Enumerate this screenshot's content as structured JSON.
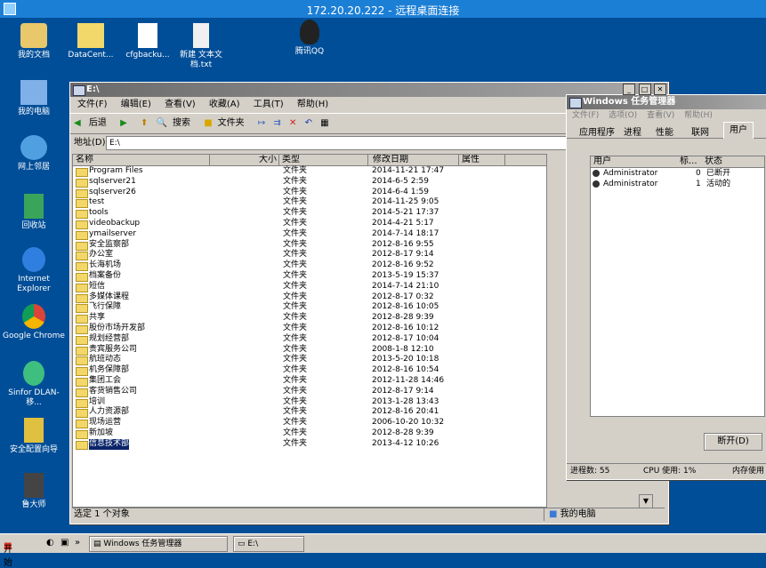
{
  "rdp": {
    "title": "172.20.20.222 - 远程桌面连接"
  },
  "desktop_icons": [
    {
      "label": "我的文档",
      "icon": "documents-icon"
    },
    {
      "label": "DataCent...",
      "icon": "folder-icon"
    },
    {
      "label": "cfgbacku...",
      "icon": "file-icon"
    },
    {
      "label": "新建 文本文档.txt",
      "icon": "text-file-icon"
    },
    {
      "label": "腾讯QQ",
      "icon": "qq-icon"
    },
    {
      "label": "我的电脑",
      "icon": "computer-icon"
    },
    {
      "label": "网上邻居",
      "icon": "network-icon"
    },
    {
      "label": "回收站",
      "icon": "recycle-bin-icon"
    },
    {
      "label": "Internet Explorer",
      "icon": "ie-icon"
    },
    {
      "label": "Google Chrome",
      "icon": "chrome-icon"
    },
    {
      "label": "Sinfor DLAN-移...",
      "icon": "sinfor-icon"
    },
    {
      "label": "安全配置向导",
      "icon": "security-wizard-icon"
    },
    {
      "label": "鲁大师",
      "icon": "ludashi-icon"
    }
  ],
  "explorer": {
    "title": "E:\\",
    "menu": [
      "文件(F)",
      "编辑(E)",
      "查看(V)",
      "收藏(A)",
      "工具(T)",
      "帮助(H)"
    ],
    "toolbar": {
      "back": "后退",
      "search": "搜索",
      "folders": "文件夹"
    },
    "address_label": "地址(D)",
    "address_value": "E:\\",
    "columns": [
      "名称",
      "大小",
      "类型",
      "修改日期",
      "属性"
    ],
    "rows": [
      {
        "name": "Program Files",
        "type": "文件夹",
        "date": "2014-11-21 17:47"
      },
      {
        "name": "sqlserver21",
        "type": "文件夹",
        "date": "2014-6-5 2:59"
      },
      {
        "name": "sqlserver26",
        "type": "文件夹",
        "date": "2014-6-4 1:59"
      },
      {
        "name": "test",
        "type": "文件夹",
        "date": "2014-11-25 9:05"
      },
      {
        "name": "tools",
        "type": "文件夹",
        "date": "2014-5-21 17:37"
      },
      {
        "name": "videobackup",
        "type": "文件夹",
        "date": "2014-4-21 5:17"
      },
      {
        "name": "ymailserver",
        "type": "文件夹",
        "date": "2014-7-14 18:17"
      },
      {
        "name": "安全监察部",
        "type": "文件夹",
        "date": "2012-8-16 9:55"
      },
      {
        "name": "办公室",
        "type": "文件夹",
        "date": "2012-8-17 9:14"
      },
      {
        "name": "长海机场",
        "type": "文件夹",
        "date": "2012-8-16 9:52"
      },
      {
        "name": "档案备份",
        "type": "文件夹",
        "date": "2013-5-19 15:37"
      },
      {
        "name": "短信",
        "type": "文件夹",
        "date": "2014-7-14 21:10"
      },
      {
        "name": "多媒体课程",
        "type": "文件夹",
        "date": "2012-8-17 0:32"
      },
      {
        "name": "飞行保障",
        "type": "文件夹",
        "date": "2012-8-16 10:05"
      },
      {
        "name": "共享",
        "type": "文件夹",
        "date": "2012-8-28 9:39"
      },
      {
        "name": "股份市场开发部",
        "type": "文件夹",
        "date": "2012-8-16 10:12"
      },
      {
        "name": "规划经营部",
        "type": "文件夹",
        "date": "2012-8-17 10:04"
      },
      {
        "name": "贵宾服务公司",
        "type": "文件夹",
        "date": "2008-1-8 12:10"
      },
      {
        "name": "航班动态",
        "type": "文件夹",
        "date": "2013-5-20 10:18"
      },
      {
        "name": "机务保障部",
        "type": "文件夹",
        "date": "2012-8-16 10:54"
      },
      {
        "name": "集团工会",
        "type": "文件夹",
        "date": "2012-11-28 14:46"
      },
      {
        "name": "客货销售公司",
        "type": "文件夹",
        "date": "2012-8-17 9:14"
      },
      {
        "name": "培训",
        "type": "文件夹",
        "date": "2013-1-28 13:43"
      },
      {
        "name": "人力资源部",
        "type": "文件夹",
        "date": "2012-8-16 20:41"
      },
      {
        "name": "现场运营",
        "type": "文件夹",
        "date": "2006-10-20 10:32"
      },
      {
        "name": "新加坡",
        "type": "文件夹",
        "date": "2012-8-28 9:39"
      },
      {
        "name": "信息技术部",
        "type": "文件夹",
        "date": "2013-4-12 10:26",
        "selected": true
      }
    ],
    "status_left": "选定 1 个对象",
    "status_right": "我的电脑"
  },
  "taskmgr": {
    "title": "Windows 任务管理器",
    "menu": [
      "文件(F)",
      "选项(O)",
      "查看(V)",
      "帮助(H)"
    ],
    "tabs": [
      "应用程序",
      "进程",
      "性能",
      "联网",
      "用户"
    ],
    "active_tab": "用户",
    "columns": [
      "用户",
      "标...",
      "状态"
    ],
    "users": [
      {
        "name": "Administrator",
        "id": "0",
        "status": "已断开"
      },
      {
        "name": "Administrator",
        "id": "1",
        "status": "活动的"
      }
    ],
    "disconnect": "断开(D)",
    "status_processes": "进程数: 55",
    "status_cpu": "CPU 使用: 1%",
    "status_mem": "内存使用"
  },
  "taskbar": {
    "start": "开始",
    "items": [
      "Windows 任务管理器",
      "E:\\"
    ]
  }
}
